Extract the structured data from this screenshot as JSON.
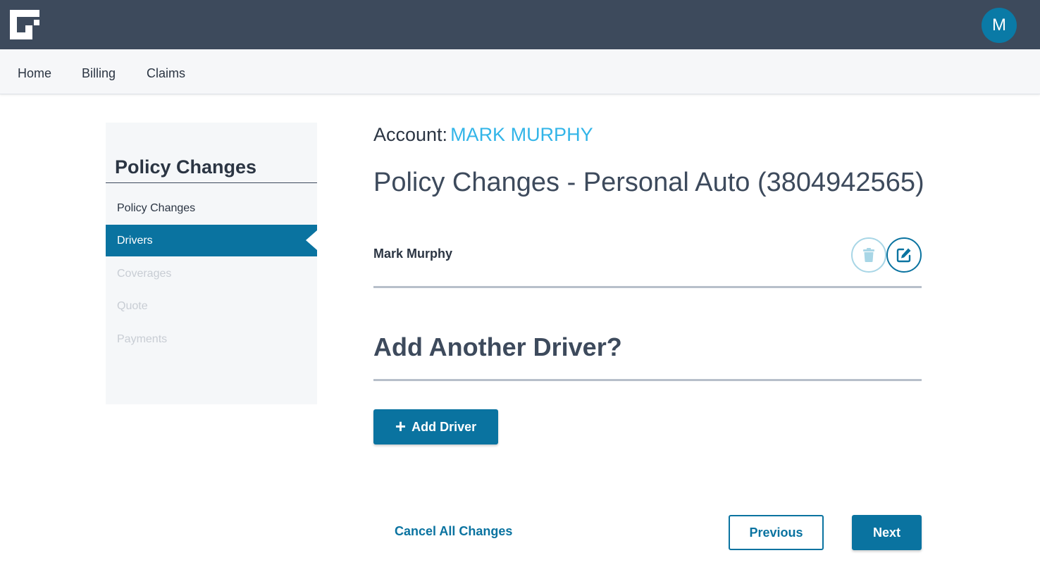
{
  "header": {
    "logo_icon": "guidewire-logo-icon",
    "avatar_initial": "M"
  },
  "nav": {
    "items": [
      "Home",
      "Billing",
      "Claims"
    ]
  },
  "sidebar": {
    "title": "Policy Changes",
    "items": [
      {
        "label": "Policy Changes",
        "state": "enabled"
      },
      {
        "label": "Drivers",
        "state": "active"
      },
      {
        "label": "Coverages",
        "state": "disabled"
      },
      {
        "label": "Quote",
        "state": "disabled"
      },
      {
        "label": "Payments",
        "state": "disabled"
      }
    ]
  },
  "main": {
    "account_label": "Account:",
    "account_name": "MARK MURPHY",
    "page_title": "Policy Changes - Personal Auto (3804942565)",
    "drivers": [
      {
        "name": "Mark Murphy",
        "delete_icon": "trash-icon",
        "edit_icon": "edit-icon"
      }
    ],
    "section_title": "Add Another Driver?",
    "add_button_label": "Add Driver"
  },
  "footer": {
    "cancel_label": "Cancel All Changes",
    "previous_label": "Previous",
    "next_label": "Next"
  },
  "colors": {
    "header_bg": "#3d4a5c",
    "accent": "#0a73a0",
    "link": "#33b5e8"
  }
}
